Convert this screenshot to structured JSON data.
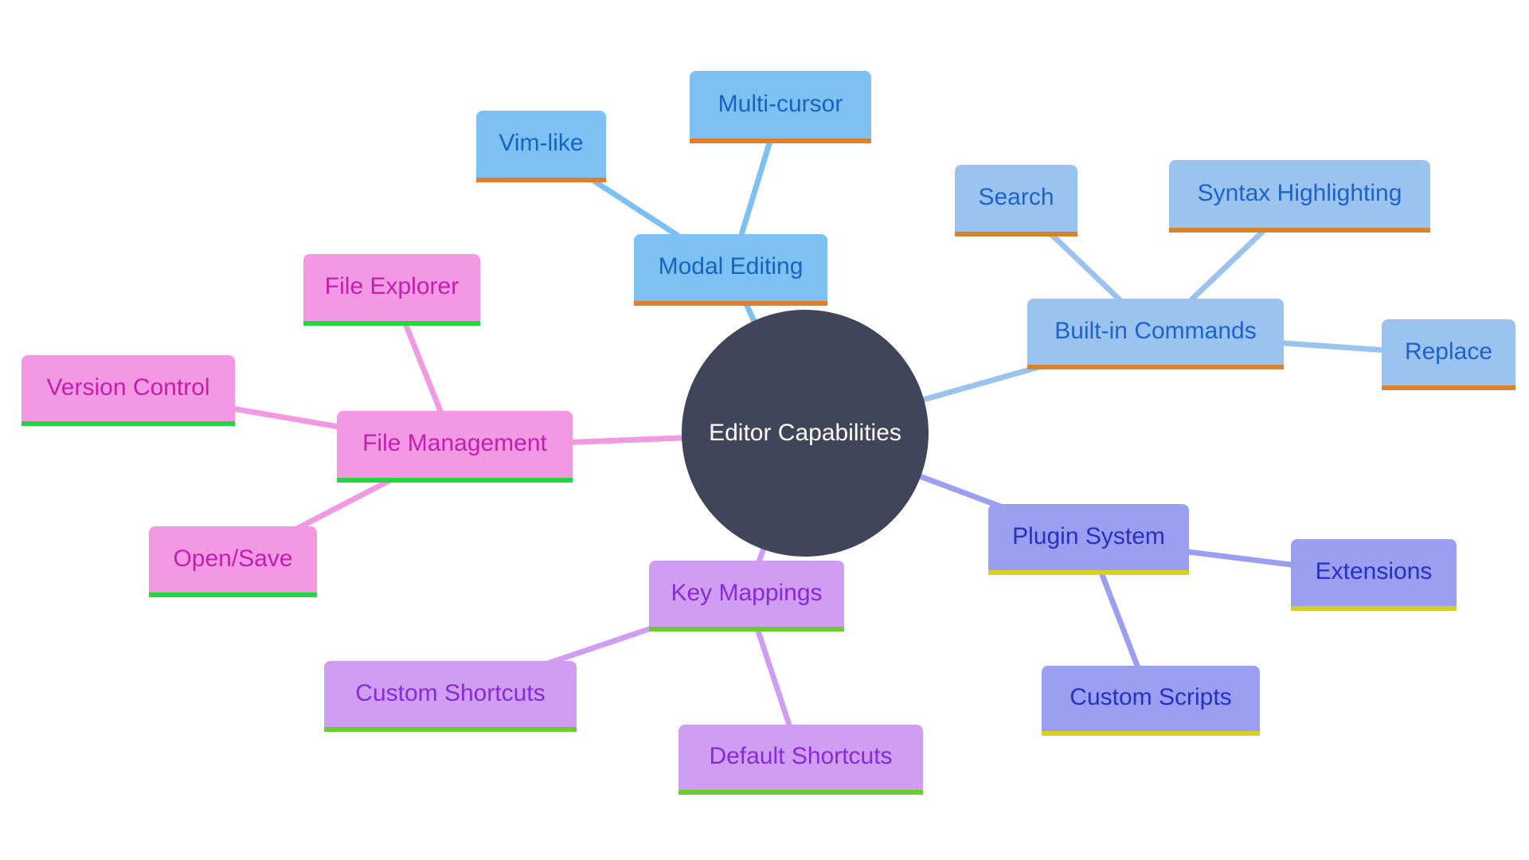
{
  "title": "Editor Capabilities",
  "colors": {
    "root_fill": "#414559",
    "modal_editing": "#7dc0f2",
    "built_in_commands": "#9bc3ef",
    "file_management": "#f398e3",
    "key_mappings": "#cf9ef2",
    "plugin_system": "#9b9ff2"
  },
  "root": {
    "label": "Editor Capabilities"
  },
  "branches": [
    {
      "id": "modal",
      "label": "Modal Editing",
      "children": [
        "Vim-like",
        "Multi-cursor"
      ]
    },
    {
      "id": "builtin",
      "label": "Built-in Commands",
      "children": [
        "Search",
        "Syntax Highlighting",
        "Replace"
      ]
    },
    {
      "id": "file",
      "label": "File Management",
      "children": [
        "File Explorer",
        "Version Control",
        "Open/Save"
      ]
    },
    {
      "id": "keys",
      "label": "Key Mappings",
      "children": [
        "Custom Shortcuts",
        "Default Shortcuts"
      ]
    },
    {
      "id": "plugin",
      "label": "Plugin System",
      "children": [
        "Extensions",
        "Custom Scripts"
      ]
    }
  ]
}
